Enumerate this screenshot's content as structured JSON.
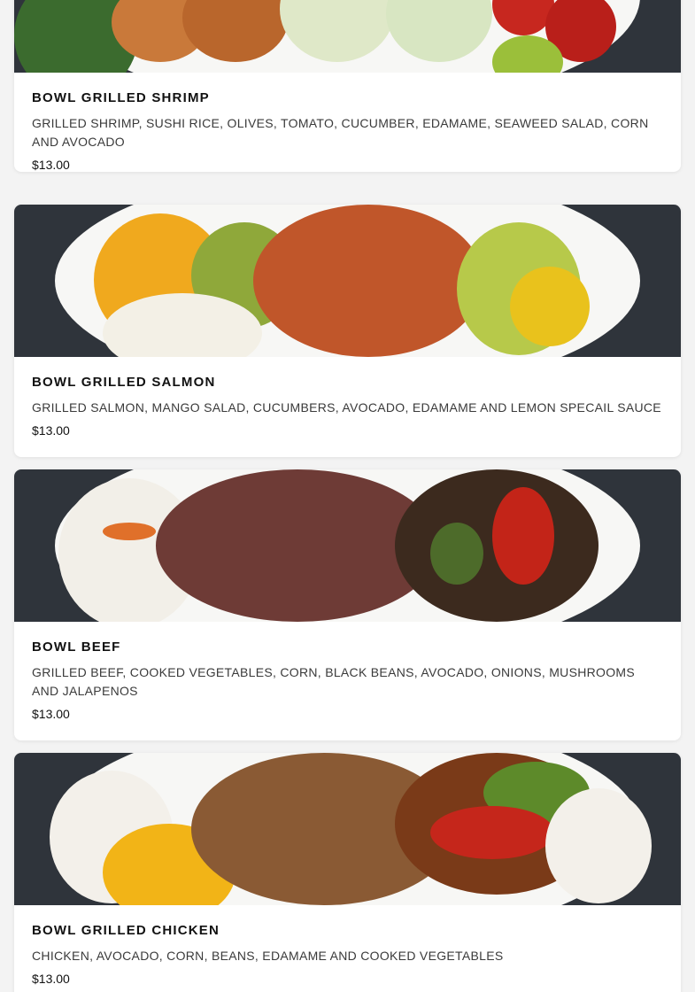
{
  "menu_items": [
    {
      "name": "BOWL GRILLED SHRIMP",
      "description": "GRILLED SHRIMP, SUSHI RICE, OLIVES, TOMATO, CUCUMBER, EDAMAME, SEAWEED SALAD, CORN AND AVOCADO",
      "price": "$13.00"
    },
    {
      "name": "BOWL GRILLED SALMON",
      "description": "GRILLED SALMON, MANGO SALAD, CUCUMBERS, AVOCADO, EDAMAME AND LEMON SPECAIL SAUCE",
      "price": "$13.00"
    },
    {
      "name": "BOWL BEEF",
      "description": "GRILLED BEEF, COOKED VEGETABLES, CORN, BLACK BEANS, AVOCADO, ONIONS, MUSHROOMS AND JALAPENOS",
      "price": "$13.00"
    },
    {
      "name": "BOWL GRILLED CHICKEN",
      "description": "CHICKEN, AVOCADO, CORN, BEANS, EDAMAME AND COOKED VEGETABLES",
      "price": "$13.00"
    }
  ],
  "colors": {
    "page_background": "#f3f3f3",
    "card_background": "#ffffff",
    "title_text": "#111111",
    "description_text": "#3a3a3a"
  }
}
